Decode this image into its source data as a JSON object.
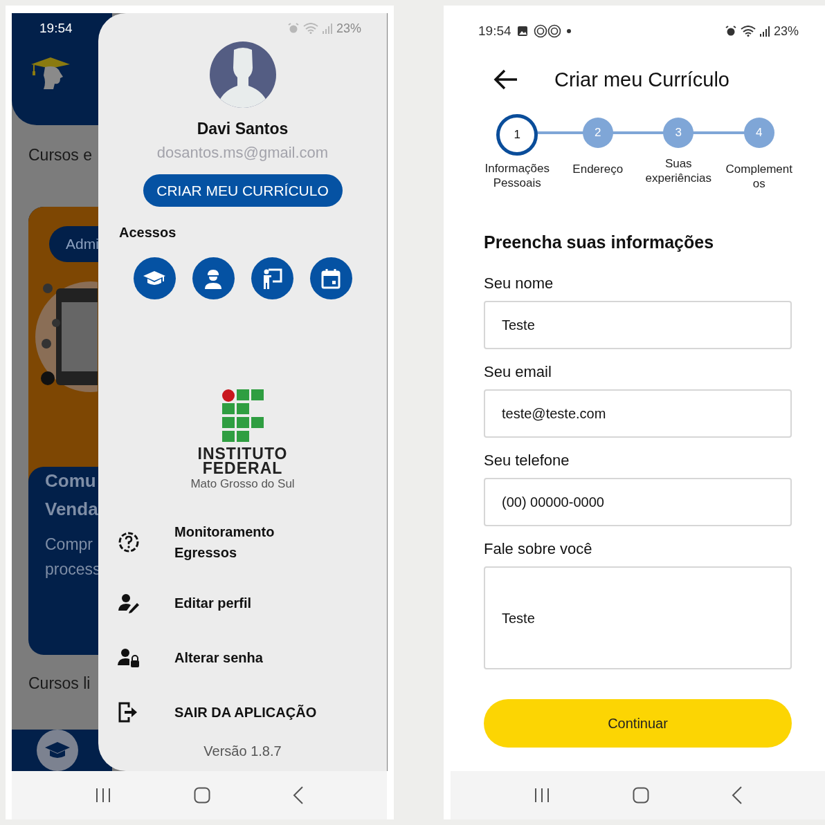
{
  "left_screen": {
    "status_bar": {
      "time": "19:54",
      "battery": "23%"
    },
    "background_app": {
      "section_1": "Cursos e",
      "chip": "Admi",
      "card_title_lines": [
        "Comu",
        "Venda"
      ],
      "card_text_lines": [
        "Compr",
        "process"
      ],
      "section_2": "Cursos li"
    },
    "drawer": {
      "user_name": "Davi Santos",
      "email": "dosantos.ms@gmail.com",
      "cv_button": "CRIAR MEU CURRÍCULO",
      "accesses_title": "Acessos",
      "logo": {
        "line_1": "INSTITUTO",
        "line_2": "FEDERAL",
        "line_3": "Mato Grosso do Sul"
      },
      "menu": [
        {
          "kind": "help",
          "label": "Monitoramento Egressos"
        },
        {
          "kind": "edit",
          "label": "Editar perfil"
        },
        {
          "kind": "password",
          "label": "Alterar senha"
        },
        {
          "kind": "logout",
          "label": "SAIR DA APLICAÇÃO"
        }
      ],
      "version": "Versão 1.8.7"
    }
  },
  "right_screen": {
    "status_bar": {
      "time": "19:54",
      "battery": "23%"
    },
    "title": "Criar meu Currículo",
    "steps": [
      {
        "number": "1",
        "label": "Informações Pessoais",
        "selected": true
      },
      {
        "number": "2",
        "label": "Endereço",
        "selected": false
      },
      {
        "number": "3",
        "label": "Suas experiências",
        "selected": false
      },
      {
        "number": "4",
        "label": "Complementos",
        "selected": false
      }
    ],
    "form_title": "Preencha suas informações",
    "fields": [
      {
        "kind": "input",
        "label": "Seu nome",
        "value": "Teste"
      },
      {
        "kind": "input",
        "label": "Seu email",
        "value": "teste@teste.com"
      },
      {
        "kind": "input",
        "label": "Seu telefone",
        "value": "(00) 00000-0000"
      },
      {
        "kind": "textarea",
        "label": "Fale sobre você",
        "value": "Teste"
      }
    ],
    "continue_button": "Continuar"
  }
}
